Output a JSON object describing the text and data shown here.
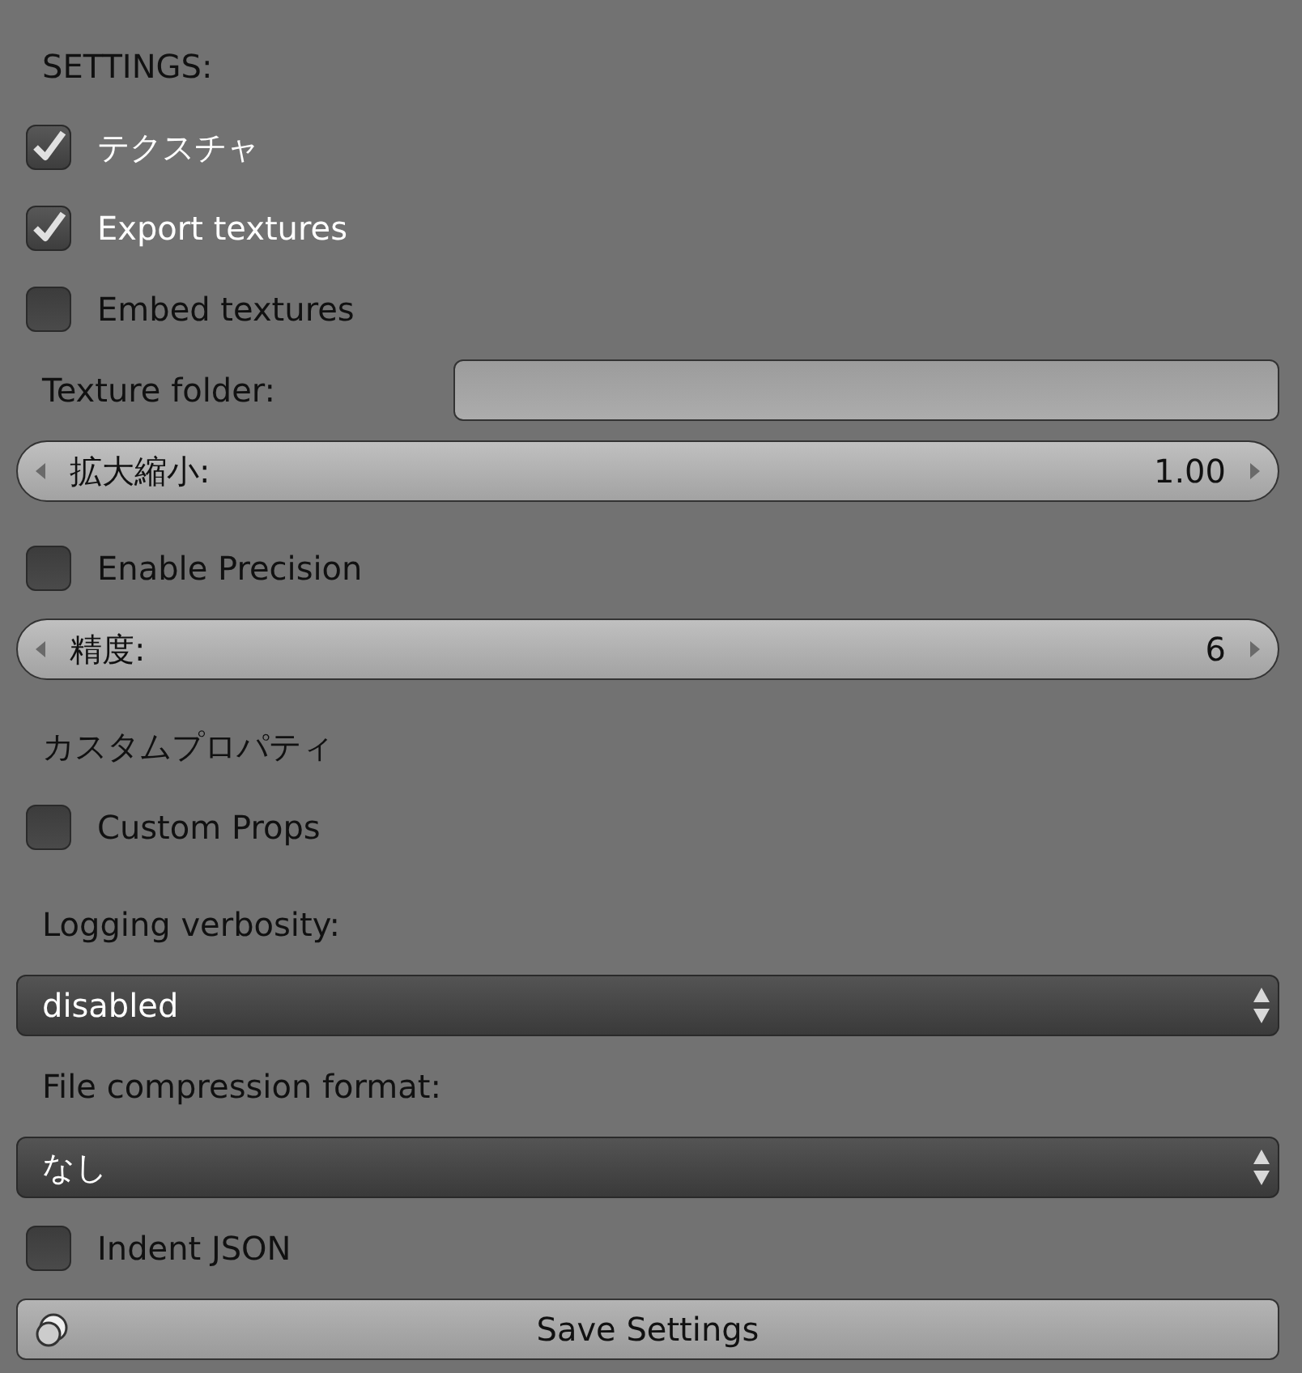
{
  "panel": {
    "rows": [
      {
        "kind": "heading",
        "label": "SETTINGS:"
      },
      {
        "kind": "checkbox",
        "label": "テクスチャ",
        "checked": true
      },
      {
        "kind": "checkbox",
        "label": "Export textures",
        "checked": true
      },
      {
        "kind": "checkbox",
        "label": "Embed textures",
        "checked": false
      },
      {
        "kind": "text_field",
        "label": "Texture folder:"
      },
      {
        "kind": "number",
        "label": "拡大縮小:",
        "value": "1.00"
      },
      {
        "kind": "checkbox",
        "label": "Enable Precision",
        "checked": false
      },
      {
        "kind": "number",
        "label": "精度:",
        "value": "6"
      },
      {
        "kind": "heading",
        "label": "カスタムプロパティ"
      },
      {
        "kind": "checkbox",
        "label": "Custom Props",
        "checked": false
      },
      {
        "kind": "heading",
        "label": "Logging verbosity:"
      },
      {
        "kind": "dropdown",
        "value": "disabled"
      },
      {
        "kind": "heading",
        "label": "File compression format:"
      },
      {
        "kind": "dropdown",
        "value": "なし"
      },
      {
        "kind": "checkbox",
        "label": "Indent JSON",
        "checked": false
      },
      {
        "kind": "button",
        "label": "Save Settings"
      }
    ]
  }
}
